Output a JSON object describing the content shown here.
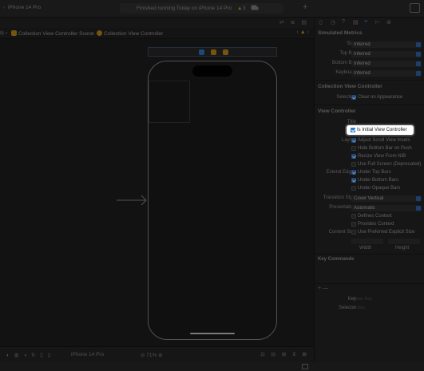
{
  "toolbar": {
    "device": "iPhone 14 Pro",
    "status": "Finished running Today on iPhone 14 Pro",
    "warning_count": "3",
    "add": "+"
  },
  "breadcrumb": {
    "truncated_prefix": "e)",
    "items": [
      "Collection View Controller Scene",
      "Collection View Controller"
    ]
  },
  "bottom_bar": {
    "device": "iPhone 14 Pro",
    "zoom": "71%"
  },
  "inspector": {
    "simulated_metrics": {
      "title": "Simulated Metrics",
      "size_label": "Size",
      "size_value": "Inferred",
      "top_bar_label": "Top Bar",
      "top_bar_value": "Inferred",
      "bottom_bar_label": "Bottom Bar",
      "bottom_bar_value": "Inferred",
      "keyboard_label": "Keyboard",
      "keyboard_value": "Inferred"
    },
    "collection_vc": {
      "title": "Collection View Controller",
      "selection_label": "Selection",
      "clear_on_appearance": "Clear on Appearance"
    },
    "view_controller": {
      "title": "View Controller",
      "title_label": "Title",
      "is_initial": "Is Initial View Controller",
      "layout_label": "Layout",
      "adjust_scroll": "Adjust Scroll View Insets",
      "hide_bottom_bar": "Hide Bottom Bar on Push",
      "resize_from_nib": "Resize View From NIB",
      "use_full_screen": "Use Full Screen (Deprecated)",
      "extend_edges_label": "Extend Edges",
      "under_top_bars": "Under Top Bars",
      "under_bottom_bars": "Under Bottom Bars",
      "under_opaque_bars": "Under Opaque Bars",
      "transition_style_label": "Transition Style",
      "transition_style_value": "Cover Vertical",
      "presentation_label": "Presentation",
      "presentation_value": "Automatic",
      "defines_context": "Defines Context",
      "provides_context": "Provides Context",
      "content_size_label": "Content Size",
      "use_preferred": "Use Preferred Explicit Size",
      "width_label": "Width",
      "height_label": "Height"
    },
    "key_commands": {
      "title": "Key Commands",
      "add": "+ —",
      "key_label": "Key",
      "key_placeholder": "Enter Key",
      "selector_label": "Selector",
      "selector_placeholder": "action"
    }
  },
  "colors": {
    "accent": "#2f7fd6",
    "warning": "#d7a223",
    "storyboard_orange": "#c8921b"
  }
}
